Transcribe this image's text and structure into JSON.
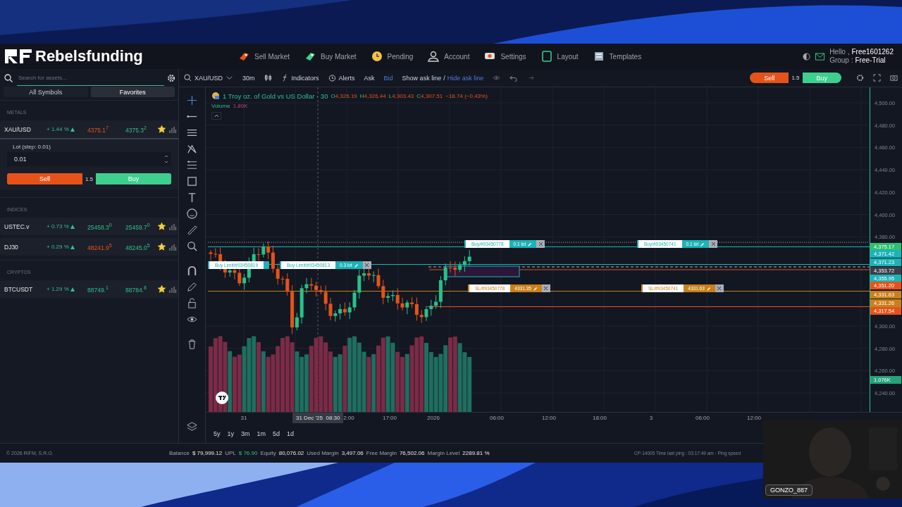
{
  "header": {
    "logo": "Rebelsfunding",
    "nav": [
      {
        "label": "Sell Market"
      },
      {
        "label": "Buy Market"
      },
      {
        "label": "Pending"
      },
      {
        "label": "Account"
      },
      {
        "label": "Settings"
      },
      {
        "label": "Layout"
      },
      {
        "label": "Templates"
      }
    ],
    "user": {
      "greeting": "Hello ,",
      "name": "Free1601262",
      "group_label": "Group :",
      "group": "Free-Trial"
    }
  },
  "sidebar": {
    "search": {
      "placeholder": "Search for assets..."
    },
    "tabs": [
      {
        "label": "All Symbols",
        "selected": false
      },
      {
        "label": "Favorites",
        "selected": true
      }
    ],
    "sections": [
      {
        "title": "METALS",
        "assets": [
          {
            "symbol": "XAU/USD",
            "change": "+ 1.44 %",
            "bid": "4375.1$^{7}$",
            "bid_down": true,
            "ask": "4375.3$^{2}$",
            "ask_down": false,
            "favorite": true,
            "expanded": true
          }
        ]
      },
      {
        "title": "INDICES",
        "assets": [
          {
            "symbol": "USTEC.v",
            "change": "+ 0.73 %",
            "bid": "25458.3$^{0}$",
            "bid_down": false,
            "ask": "25459.7$^{0}$",
            "ask_down": false,
            "favorite": true,
            "expanded": false
          },
          {
            "symbol": "DJ30",
            "change": "+ 0.29 %",
            "bid": "48241.9$^{5}$",
            "bid_down": true,
            "ask": "48245.0$^{5}$",
            "ask_down": false,
            "favorite": true,
            "expanded": false
          }
        ]
      },
      {
        "title": "CRYPTOS",
        "assets": [
          {
            "symbol": "BTCUSDT",
            "change": "+ 1.29 %",
            "bid": "88749.$^{1}$",
            "bid_down": false,
            "ask": "88784.$^{8}$",
            "ask_down": false,
            "favorite": true,
            "expanded": false
          }
        ]
      }
    ],
    "trade_panel": {
      "lot_label": "Lot  (step: 0.01)",
      "lot": "0.01",
      "sell": "Sell",
      "spread": "1.5",
      "buy": "Buy"
    }
  },
  "toolbar": {
    "symbol": "XAU/USD",
    "interval": "30m",
    "indicators": "Indicators",
    "alerts": "Alerts",
    "price_source": [
      {
        "label": "Ask",
        "selected": false
      },
      {
        "label": "Bid",
        "selected": true
      }
    ],
    "show_ask_line": "Show ask line",
    "separator": "/",
    "hide_ask_line": "Hide ask line",
    "sell": "Sell",
    "spread": "1.5",
    "buy": "Buy"
  },
  "chart": {
    "title": "1 Troy oz. of Gold vs US Dollar · 30",
    "ohlc": [
      {
        "key": "O",
        "value": "4,326.19"
      },
      {
        "key": "H",
        "value": "4,326.44"
      },
      {
        "key": "L",
        "value": "4,303.43"
      },
      {
        "key": "C",
        "value": "4,307.51"
      }
    ],
    "change": "−18.74 (−0.43%)",
    "volume_label": "Volume",
    "volume_value": "1.89K",
    "orders": [
      {
        "kind": "limit",
        "label": "Buy Limit/#93450819"
      },
      {
        "kind": "buy",
        "label": "Buy Limit/#93450813",
        "value": "0.3 lot"
      },
      {
        "kind": "buy",
        "label": "Buy/#93450778",
        "value": "0.1 lot"
      },
      {
        "kind": "buy",
        "label": "Buy/#93450741",
        "value": "0.1 lot"
      },
      {
        "kind": "sl",
        "label": "SL/#93450778",
        "value": "4331.35"
      },
      {
        "kind": "sl",
        "label": "SL/#93450741",
        "value": "4331.63"
      }
    ],
    "price_ticks": [
      "4,500.00",
      "4,480.00",
      "4,460.00",
      "4,440.00",
      "4,420.00",
      "4,400.00",
      "4,380.00",
      "4,300.00",
      "4,280.00",
      "4,260.00",
      "4,240.00"
    ],
    "price_tags": [
      {
        "value": "4,375.17",
        "color": "#2fbf71"
      },
      {
        "value": "4,371.42",
        "color": "#1bb3b8"
      },
      {
        "value": "4,371.23",
        "color": "#1bb3b8"
      },
      {
        "value": "4,353.72",
        "color": "#3a3e4a"
      },
      {
        "value": "4,355.95",
        "color": "#1bb3b8"
      },
      {
        "value": "4,351.20",
        "color": "#e5531a"
      },
      {
        "value": "4,331.63",
        "color": "#c9801a"
      },
      {
        "value": "4,331.26",
        "color": "#c9801a"
      },
      {
        "value": "4,317.54",
        "color": "#e5531a"
      },
      {
        "value": "1.076K",
        "color": "#26a27a"
      }
    ],
    "time_labels": [
      "31",
      "2:00",
      "17:00",
      "2026",
      "06:00",
      "12:00",
      "18:00",
      "3",
      "06:00",
      "12:00"
    ],
    "crosshair_time": "31 Dec '25  08:30",
    "ranges": [
      "5y",
      "1y",
      "3m",
      "1m",
      "5d",
      "1d"
    ]
  },
  "footer": {
    "copyright": "© 2026 RIFM, S.R.O.",
    "stats": [
      {
        "label": "Balance",
        "value": "$ 79,999.12",
        "positive": false
      },
      {
        "label": "UPL",
        "value": "$ 76.90",
        "positive": true
      },
      {
        "label": "Equity",
        "value": "80,076.02",
        "positive": false
      },
      {
        "label": "Used Margin",
        "value": "3,497.06",
        "positive": false
      },
      {
        "label": "Free Margin",
        "value": "76,502.06",
        "positive": false
      },
      {
        "label": "Margin Level",
        "value": "2289.81 %",
        "positive": false
      }
    ],
    "status": "CP-14005 Time last ping : 03:17:49 am · Ping speed"
  },
  "webcam": {
    "kind": "picture",
    "name": "GONZO_887"
  }
}
